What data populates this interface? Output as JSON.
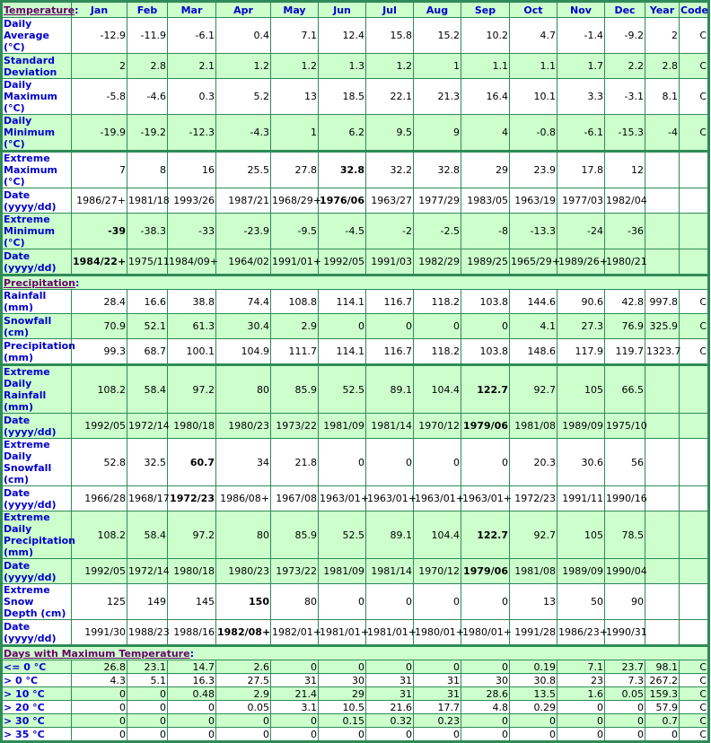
{
  "header": {
    "first": "Temperature",
    "months": [
      "Jan",
      "Feb",
      "Mar",
      "Apr",
      "May",
      "Jun",
      "Jul",
      "Aug",
      "Sep",
      "Oct",
      "Nov",
      "Dec"
    ],
    "year": "Year",
    "code": "Code"
  },
  "sections": {
    "temperature": "Temperature",
    "precipitation": "Precipitation",
    "days_max_temp": "Days with Maximum Temperature"
  },
  "rows": [
    {
      "label": "Daily Average (°C)",
      "values": [
        "-12.9",
        "-11.9",
        "-6.1",
        "0.4",
        "7.1",
        "12.4",
        "15.8",
        "15.2",
        "10.2",
        "4.7",
        "-1.4",
        "-9.2"
      ],
      "year": "2",
      "code": "C",
      "bold": []
    },
    {
      "label": "Standard Deviation",
      "values": [
        "2",
        "2.8",
        "2.1",
        "1.2",
        "1.2",
        "1.3",
        "1.2",
        "1",
        "1.1",
        "1.1",
        "1.7",
        "2.2"
      ],
      "year": "2.8",
      "code": "C",
      "bold": []
    },
    {
      "label": "Daily Maximum (°C)",
      "values": [
        "-5.8",
        "-4.6",
        "0.3",
        "5.2",
        "13",
        "18.5",
        "22.1",
        "21.3",
        "16.4",
        "10.1",
        "3.3",
        "-3.1"
      ],
      "year": "8.1",
      "code": "C",
      "bold": []
    },
    {
      "label": "Daily Minimum (°C)",
      "values": [
        "-19.9",
        "-19.2",
        "-12.3",
        "-4.3",
        "1",
        "6.2",
        "9.5",
        "9",
        "4",
        "-0.8",
        "-6.1",
        "-15.3"
      ],
      "year": "-4",
      "code": "C",
      "bold": []
    },
    {
      "label": "Extreme Maximum (°C)",
      "values": [
        "7",
        "8",
        "16",
        "25.5",
        "27.8",
        "32.8",
        "32.2",
        "32.8",
        "29",
        "23.9",
        "17.8",
        "12"
      ],
      "year": "",
      "code": "",
      "bold": [
        5
      ]
    },
    {
      "label": "Date (yyyy/dd)",
      "values": [
        "1986/27+",
        "1981/18",
        "1993/26",
        "1987/21",
        "1968/29+",
        "1976/06",
        "1963/27",
        "1977/29",
        "1983/05",
        "1963/19",
        "1977/03",
        "1982/04"
      ],
      "year": "",
      "code": "",
      "bold": [
        5
      ]
    },
    {
      "label": "Extreme Minimum (°C)",
      "values": [
        "-39",
        "-38.3",
        "-33",
        "-23.9",
        "-9.5",
        "-4.5",
        "-2",
        "-2.5",
        "-8",
        "-13.3",
        "-24",
        "-36"
      ],
      "year": "",
      "code": "",
      "bold": [
        0
      ]
    },
    {
      "label": "Date (yyyy/dd)",
      "values": [
        "1984/22+",
        "1975/11",
        "1984/09+",
        "1964/02",
        "1991/01+",
        "1992/05",
        "1991/03",
        "1982/29",
        "1989/25",
        "1965/29+",
        "1989/26+",
        "1980/21"
      ],
      "year": "",
      "code": "",
      "bold": [
        0
      ]
    },
    {
      "label": "Rainfall (mm)",
      "values": [
        "28.4",
        "16.6",
        "38.8",
        "74.4",
        "108.8",
        "114.1",
        "116.7",
        "118.2",
        "103.8",
        "144.6",
        "90.6",
        "42.8"
      ],
      "year": "997.8",
      "code": "C",
      "bold": []
    },
    {
      "label": "Snowfall (cm)",
      "values": [
        "70.9",
        "52.1",
        "61.3",
        "30.4",
        "2.9",
        "0",
        "0",
        "0",
        "0",
        "4.1",
        "27.3",
        "76.9"
      ],
      "year": "325.9",
      "code": "C",
      "bold": []
    },
    {
      "label": "Precipitation (mm)",
      "values": [
        "99.3",
        "68.7",
        "100.1",
        "104.9",
        "111.7",
        "114.1",
        "116.7",
        "118.2",
        "103.8",
        "148.6",
        "117.9",
        "119.7"
      ],
      "year": "1323.7",
      "code": "C",
      "bold": []
    },
    {
      "label": "Extreme Daily Rainfall (mm)",
      "values": [
        "108.2",
        "58.4",
        "97.2",
        "80",
        "85.9",
        "52.5",
        "89.1",
        "104.4",
        "122.7",
        "92.7",
        "105",
        "66.5"
      ],
      "year": "",
      "code": "",
      "bold": [
        8
      ]
    },
    {
      "label": "Date (yyyy/dd)",
      "values": [
        "1992/05",
        "1972/14",
        "1980/18",
        "1980/23",
        "1973/22",
        "1981/09",
        "1981/14",
        "1970/12",
        "1979/06",
        "1981/08",
        "1989/09",
        "1975/10"
      ],
      "year": "",
      "code": "",
      "bold": [
        8
      ]
    },
    {
      "label": "Extreme Daily Snowfall (cm)",
      "values": [
        "52.8",
        "32.5",
        "60.7",
        "34",
        "21.8",
        "0",
        "0",
        "0",
        "0",
        "20.3",
        "30.6",
        "56"
      ],
      "year": "",
      "code": "",
      "bold": [
        2
      ]
    },
    {
      "label": "Date (yyyy/dd)",
      "values": [
        "1966/28",
        "1968/17",
        "1972/23",
        "1986/08+",
        "1967/08",
        "1963/01+",
        "1963/01+",
        "1963/01+",
        "1963/01+",
        "1972/23",
        "1991/11",
        "1990/16"
      ],
      "year": "",
      "code": "",
      "bold": [
        2
      ]
    },
    {
      "label": "Extreme Daily Precipitation (mm)",
      "values": [
        "108.2",
        "58.4",
        "97.2",
        "80",
        "85.9",
        "52.5",
        "89.1",
        "104.4",
        "122.7",
        "92.7",
        "105",
        "78.5"
      ],
      "year": "",
      "code": "",
      "bold": [
        8
      ]
    },
    {
      "label": "Date (yyyy/dd)",
      "values": [
        "1992/05",
        "1972/14",
        "1980/18",
        "1980/23",
        "1973/22",
        "1981/09",
        "1981/14",
        "1970/12",
        "1979/06",
        "1981/08",
        "1989/09",
        "1990/04"
      ],
      "year": "",
      "code": "",
      "bold": [
        8
      ]
    },
    {
      "label": "Extreme Snow Depth (cm)",
      "values": [
        "125",
        "149",
        "145",
        "150",
        "80",
        "0",
        "0",
        "0",
        "0",
        "13",
        "50",
        "90"
      ],
      "year": "",
      "code": "",
      "bold": [
        3
      ]
    },
    {
      "label": "Date (yyyy/dd)",
      "values": [
        "1991/30",
        "1988/23",
        "1988/16",
        "1982/08+",
        "1982/01+",
        "1981/01+",
        "1981/01+",
        "1980/01+",
        "1980/01+",
        "1991/28",
        "1986/23+",
        "1990/31"
      ],
      "year": "",
      "code": "",
      "bold": [
        3
      ]
    },
    {
      "label": "<= 0 °C",
      "values": [
        "26.8",
        "23.1",
        "14.7",
        "2.6",
        "0",
        "0",
        "0",
        "0",
        "0",
        "0.19",
        "7.1",
        "23.7"
      ],
      "year": "98.1",
      "code": "C",
      "bold": []
    },
    {
      "label": "> 0 °C",
      "values": [
        "4.3",
        "5.1",
        "16.3",
        "27.5",
        "31",
        "30",
        "31",
        "31",
        "30",
        "30.8",
        "23",
        "7.3"
      ],
      "year": "267.2",
      "code": "C",
      "bold": []
    },
    {
      "label": "> 10 °C",
      "values": [
        "0",
        "0",
        "0.48",
        "2.9",
        "21.4",
        "29",
        "31",
        "31",
        "28.6",
        "13.5",
        "1.6",
        "0.05"
      ],
      "year": "159.3",
      "code": "C",
      "bold": []
    },
    {
      "label": "> 20 °C",
      "values": [
        "0",
        "0",
        "0",
        "0.05",
        "3.1",
        "10.5",
        "21.6",
        "17.7",
        "4.8",
        "0.29",
        "0",
        "0"
      ],
      "year": "57.9",
      "code": "C",
      "bold": []
    },
    {
      "label": "> 30 °C",
      "values": [
        "0",
        "0",
        "0",
        "0",
        "0",
        "0.15",
        "0.32",
        "0.23",
        "0",
        "0",
        "0",
        "0"
      ],
      "year": "0.7",
      "code": "C",
      "bold": []
    },
    {
      "label": "> 35 °C",
      "values": [
        "0",
        "0",
        "0",
        "0",
        "0",
        "0",
        "0",
        "0",
        "0",
        "0",
        "0",
        "0"
      ],
      "year": "0",
      "code": "C",
      "bold": []
    }
  ]
}
